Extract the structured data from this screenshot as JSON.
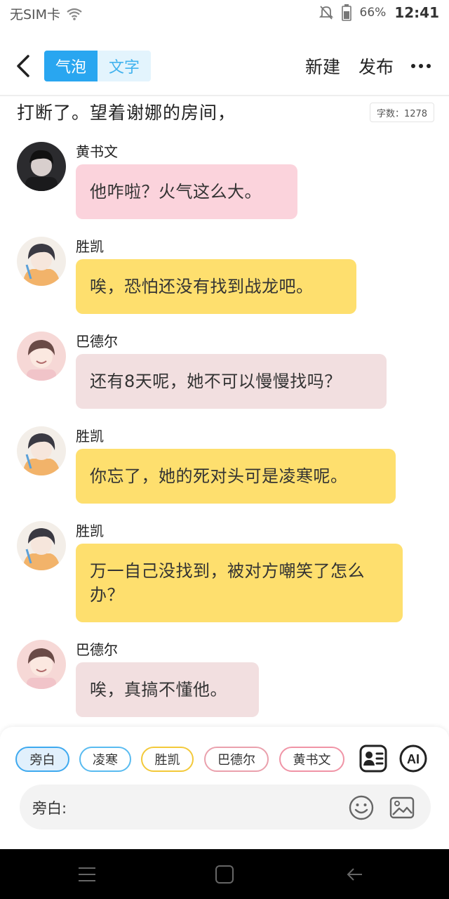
{
  "status_bar": {
    "carrier": "无SIM卡",
    "battery": "66%",
    "time": "12:41"
  },
  "toolbar": {
    "tabs": [
      {
        "label": "气泡",
        "active": true
      },
      {
        "label": "文字",
        "active": false
      }
    ],
    "new_label": "新建",
    "publish_label": "发布",
    "accent_color": "#29a6f0"
  },
  "editor": {
    "narration_line": "打断了。望着谢娜的房间，",
    "word_count": "字数：1278"
  },
  "messages": [
    {
      "speaker": "黄书文",
      "text": "他咋啦？火气这么大。",
      "bubble_color": "#fbd3dc",
      "avatar": "dark-hair-boy-avatar"
    },
    {
      "speaker": "胜凯",
      "text": "唉，恐怕还没有找到战龙吧。",
      "bubble_color": "#fedf6e",
      "avatar": "anime-boy-avatar"
    },
    {
      "speaker": "巴德尔",
      "text": "还有8天呢，她不可以慢慢找吗？",
      "bubble_color": "#f2dfe0",
      "avatar": "smiling-boy-avatar"
    },
    {
      "speaker": "胜凯",
      "text": "你忘了，她的死对头可是凌寒呢。",
      "bubble_color": "#fedf6e",
      "avatar": "anime-boy-avatar"
    },
    {
      "speaker": "胜凯",
      "text": "万一自己没找到，被对方嘲笑了怎么办？",
      "bubble_color": "#fedf6e",
      "avatar": "anime-boy-avatar"
    },
    {
      "speaker": "巴德尔",
      "text": "唉，真搞不懂他。",
      "bubble_color": "#f2dfe0",
      "avatar": "smiling-boy-avatar"
    }
  ],
  "role_chips": [
    {
      "label": "旁白",
      "color": "#3ea9ef",
      "selected": true
    },
    {
      "label": "凌寒",
      "color": "#59bbf0",
      "selected": false
    },
    {
      "label": "胜凯",
      "color": "#f3c93a",
      "selected": false
    },
    {
      "label": "巴德尔",
      "color": "#eaa1ad",
      "selected": false
    },
    {
      "label": "黄书文",
      "color": "#f094a6",
      "selected": false
    }
  ],
  "composer": {
    "label": "旁白:",
    "ai_label": "AI"
  }
}
